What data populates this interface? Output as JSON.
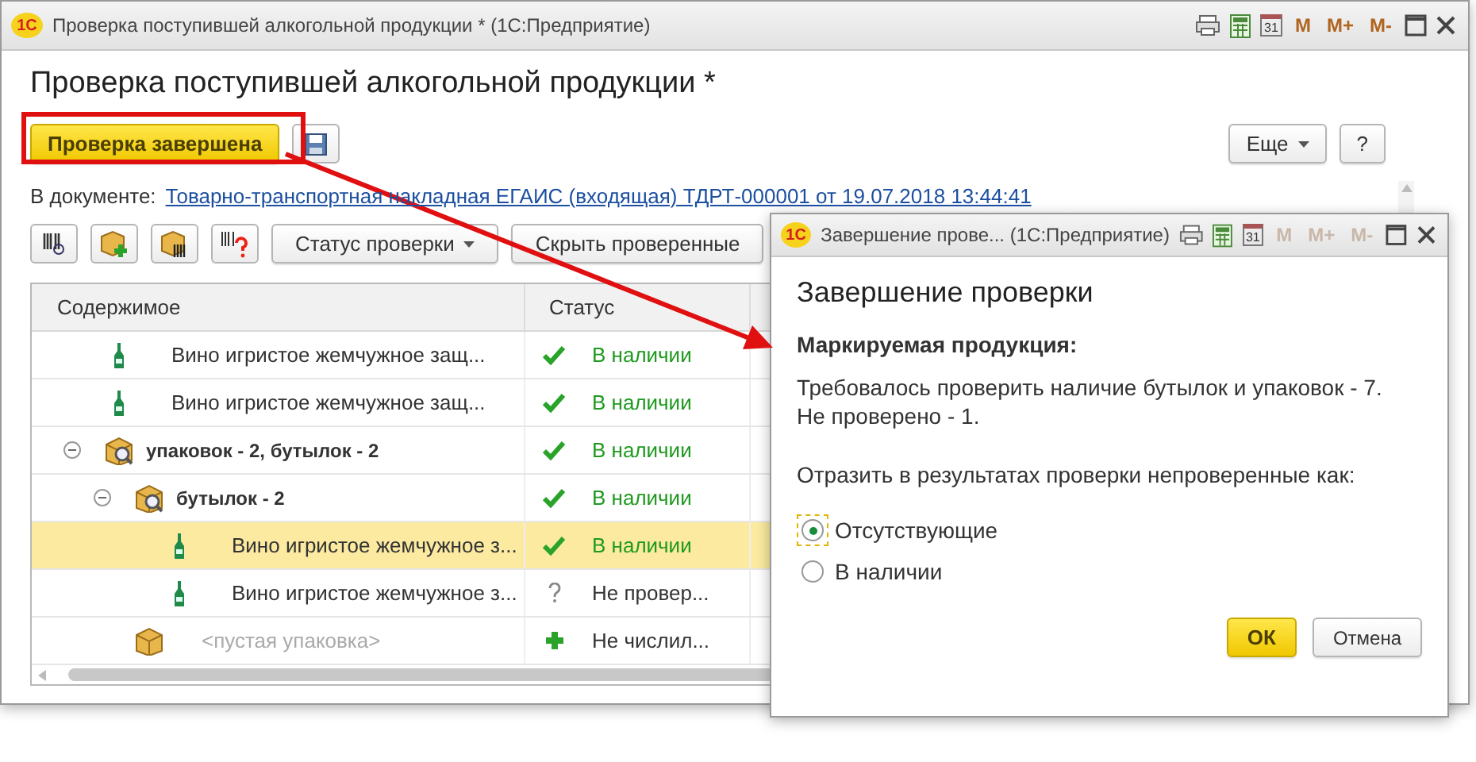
{
  "main_window": {
    "logo": "1С",
    "title": "Проверка поступившей алкогольной продукции *  (1С:Предприятие)",
    "calendar_day": "31",
    "memory_buttons": [
      {
        "label": "M",
        "disabled": false
      },
      {
        "label": "M+",
        "disabled": false
      },
      {
        "label": "M-",
        "disabled": false
      }
    ],
    "heading": "Проверка поступившей алкогольной продукции *",
    "primary_button": "Проверка завершена",
    "more_button": "Еще",
    "help_button": "?",
    "document_label": "В документе:",
    "document_link": "Товарно-транспортная накладная ЕГАИС (входящая) ТДРТ-000001 от 19.07.2018 13:44:41",
    "toolbar": {
      "status_filter": "Статус проверки",
      "hide_button": "Скрыть проверенные"
    },
    "table": {
      "columns": [
        "Содержимое",
        "Статус"
      ],
      "rows": [
        {
          "kind": "bottle",
          "text": "Вино игристое жемчужное защ...",
          "status": {
            "kind": "check",
            "text": "В наличии"
          },
          "selected": false
        },
        {
          "kind": "bottle",
          "text": "Вино игристое жемчужное защ...",
          "status": {
            "kind": "check",
            "text": "В наличии"
          },
          "selected": false
        },
        {
          "kind": "package",
          "text": "упаковок - 2, бутылок - 2",
          "status": {
            "kind": "check",
            "text": "В наличии"
          },
          "selected": false,
          "expanded": true,
          "children": [
            {
              "kind": "package",
              "text": "бутылок - 2",
              "status": {
                "kind": "check",
                "text": "В наличии"
              },
              "selected": false,
              "expanded": true,
              "children": [
                {
                  "kind": "bottle",
                  "text": "Вино игристое жемчужное з...",
                  "status": {
                    "kind": "check",
                    "text": "В наличии"
                  },
                  "selected": true
                },
                {
                  "kind": "bottle",
                  "text": "Вино игристое жемчужное з...",
                  "status": {
                    "kind": "question",
                    "text": "Не провер..."
                  },
                  "selected": false
                }
              ]
            },
            {
              "kind": "box",
              "text": "<пустая упаковка>",
              "status": {
                "kind": "plus",
                "text": "Не числил..."
              },
              "selected": false
            }
          ]
        }
      ]
    }
  },
  "dialog": {
    "logo": "1С",
    "title": "Завершение прове...  (1С:Предприятие)",
    "calendar_day": "31",
    "memory_buttons": [
      {
        "label": "M",
        "disabled": true
      },
      {
        "label": "M+",
        "disabled": true
      },
      {
        "label": "M-",
        "disabled": true
      }
    ],
    "heading": "Завершение проверки",
    "subheading": "Маркируемая продукция:",
    "message_lines": [
      "Требовалось проверить наличие бутылок и упаковок - 7.",
      "Не проверено - 1."
    ],
    "question": "Отразить в результатах проверки непроверенные как:",
    "options": [
      {
        "label": "Отсутствующие",
        "selected": true
      },
      {
        "label": "В наличии",
        "selected": false
      }
    ],
    "ok_button": "ОК",
    "cancel_button": "Отмена"
  }
}
